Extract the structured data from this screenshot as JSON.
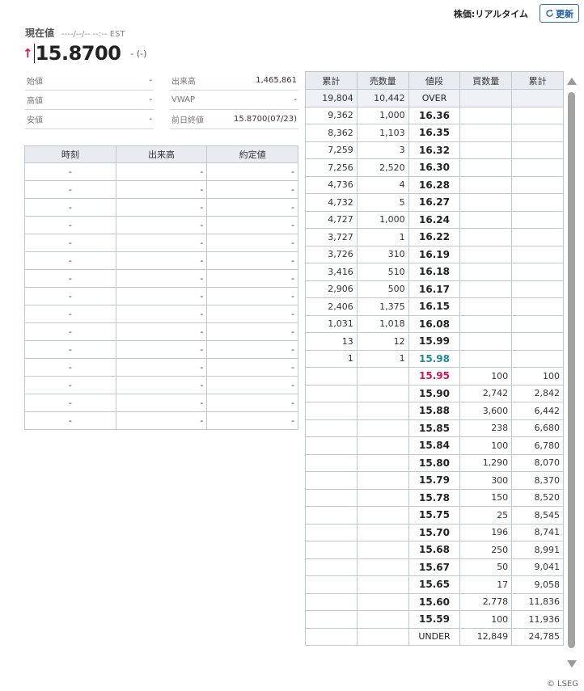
{
  "header": {
    "mode_label": "株価:リアルタイム",
    "refresh_label": "更新",
    "current_label": "現在値",
    "current_time": "----/--/-- --:-- EST",
    "arrow": "↑",
    "price": "15.8700",
    "change": "- (-)"
  },
  "stats": [
    [
      {
        "label": "始値",
        "value": "-"
      },
      {
        "label": "出来高",
        "value": "1,465,861"
      }
    ],
    [
      {
        "label": "高値",
        "value": "-"
      },
      {
        "label": "VWAP",
        "value": "-"
      }
    ],
    [
      {
        "label": "安値",
        "value": "-"
      },
      {
        "label": "前日終値",
        "value": "15.8700(07/23)"
      }
    ]
  ],
  "trades": {
    "headers": [
      "時刻",
      "出来高",
      "約定値"
    ],
    "rows": [
      [
        "-",
        "-",
        "-"
      ],
      [
        "-",
        "-",
        "-"
      ],
      [
        "-",
        "-",
        "-"
      ],
      [
        "-",
        "-",
        "-"
      ],
      [
        "-",
        "-",
        "-"
      ],
      [
        "-",
        "-",
        "-"
      ],
      [
        "-",
        "-",
        "-"
      ],
      [
        "-",
        "-",
        "-"
      ],
      [
        "-",
        "-",
        "-"
      ],
      [
        "-",
        "-",
        "-"
      ],
      [
        "-",
        "-",
        "-"
      ],
      [
        "-",
        "-",
        "-"
      ],
      [
        "-",
        "-",
        "-"
      ],
      [
        "-",
        "-",
        "-"
      ],
      [
        "-",
        "-",
        "-"
      ]
    ]
  },
  "board": {
    "headers": [
      "累計",
      "売数量",
      "値段",
      "買数量",
      "累計"
    ],
    "rows": [
      [
        "19,804",
        "10,442",
        "OVER",
        "",
        ""
      ],
      [
        "9,362",
        "1,000",
        "16.36",
        "",
        ""
      ],
      [
        "8,362",
        "1,103",
        "16.35",
        "",
        ""
      ],
      [
        "7,259",
        "3",
        "16.32",
        "",
        ""
      ],
      [
        "7,256",
        "2,520",
        "16.30",
        "",
        ""
      ],
      [
        "4,736",
        "4",
        "16.28",
        "",
        ""
      ],
      [
        "4,732",
        "5",
        "16.27",
        "",
        ""
      ],
      [
        "4,727",
        "1,000",
        "16.24",
        "",
        ""
      ],
      [
        "3,727",
        "1",
        "16.22",
        "",
        ""
      ],
      [
        "3,726",
        "310",
        "16.19",
        "",
        ""
      ],
      [
        "3,416",
        "510",
        "16.18",
        "",
        ""
      ],
      [
        "2,906",
        "500",
        "16.17",
        "",
        ""
      ],
      [
        "2,406",
        "1,375",
        "16.15",
        "",
        ""
      ],
      [
        "1,031",
        "1,018",
        "16.08",
        "",
        ""
      ],
      [
        "13",
        "12",
        "15.99",
        "",
        ""
      ],
      [
        "1",
        "1",
        "15.98",
        "",
        ""
      ],
      [
        "",
        "",
        "15.95",
        "100",
        "100"
      ],
      [
        "",
        "",
        "15.90",
        "2,742",
        "2,842"
      ],
      [
        "",
        "",
        "15.88",
        "3,600",
        "6,442"
      ],
      [
        "",
        "",
        "15.85",
        "238",
        "6,680"
      ],
      [
        "",
        "",
        "15.84",
        "100",
        "6,780"
      ],
      [
        "",
        "",
        "15.80",
        "1,290",
        "8,070"
      ],
      [
        "",
        "",
        "15.79",
        "300",
        "8,370"
      ],
      [
        "",
        "",
        "15.78",
        "150",
        "8,520"
      ],
      [
        "",
        "",
        "15.75",
        "25",
        "8,545"
      ],
      [
        "",
        "",
        "15.70",
        "196",
        "8,741"
      ],
      [
        "",
        "",
        "15.68",
        "250",
        "8,991"
      ],
      [
        "",
        "",
        "15.67",
        "50",
        "9,041"
      ],
      [
        "",
        "",
        "15.65",
        "17",
        "9,058"
      ],
      [
        "",
        "",
        "15.60",
        "2,778",
        "11,836"
      ],
      [
        "",
        "",
        "15.59",
        "100",
        "11,936"
      ],
      [
        "",
        "",
        "UNDER",
        "12,849",
        "24,785"
      ]
    ]
  },
  "colors": {
    "up": "#d0155c",
    "best_ask": "#1f8b91",
    "best_bid": "#d0155c",
    "accent": "#2c6fb4"
  },
  "icons": {
    "refresh": "refresh-icon",
    "arrow": "arrow-up-icon"
  },
  "footer": "© LSEG"
}
